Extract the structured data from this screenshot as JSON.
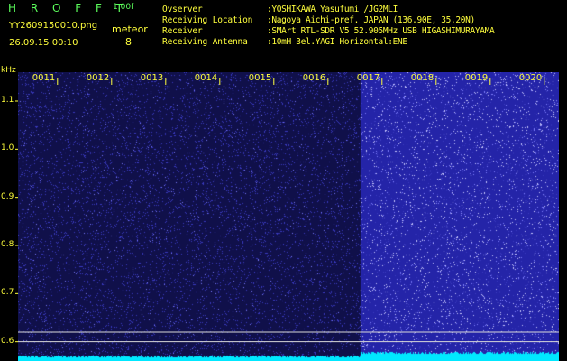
{
  "header": {
    "app_title": "H R O F F T",
    "version": "1.00f",
    "filename": "YY2609150010.png",
    "datetime": "26.09.15 00:10",
    "meteor_label": "meteor",
    "meteor_count": "8"
  },
  "info": {
    "observer_key": "Ovserver",
    "observer_val": ":YOSHIKAWA Yasufumi /JG2MLI",
    "location_key": "Receiving Location",
    "location_val": ":Nagoya Aichi-pref. JAPAN (136.90E, 35.20N)",
    "receiver_key": "Receiver",
    "receiver_val": ":SMArt RTL-SDR V5 52.905MHz USB HIGASHIMURAYAMA",
    "antenna_key": "Receiving Antenna",
    "antenna_val": ":10mH 3el.YAGI Horizontal:ENE"
  },
  "chart_data": {
    "type": "heatmap",
    "ylabel": "kHz",
    "y_ticks": [
      {
        "value": 1.1,
        "label": "1.1"
      },
      {
        "value": 1.0,
        "label": "1.0"
      },
      {
        "value": 0.9,
        "label": "0.9"
      },
      {
        "value": 0.8,
        "label": "0.8"
      },
      {
        "value": 0.7,
        "label": "0.7"
      },
      {
        "value": 0.6,
        "label": "0.6"
      }
    ],
    "ylim": [
      0.56,
      1.16
    ],
    "x_ticks": [
      "0011",
      "0012",
      "0013",
      "0014",
      "0015",
      "0016",
      "0017",
      "0018",
      "0019",
      "0020"
    ],
    "x_minutes": [
      11,
      12,
      13,
      14,
      15,
      16,
      17,
      18,
      19,
      20
    ],
    "xlim": [
      10.27,
      20.27
    ],
    "bright_segment_start_minute": 16.6,
    "reference_lines_khz": [
      0.62,
      0.6
    ],
    "colors": {
      "background_dim": "#10104a",
      "background_bright": "#2424a8",
      "noise_dim": "#3a3ac0",
      "noise_bright": "#c8c8ff",
      "baseline": "#00e8ff",
      "ref_line": "#d8d8d8",
      "tick": "#ffff3c"
    }
  }
}
